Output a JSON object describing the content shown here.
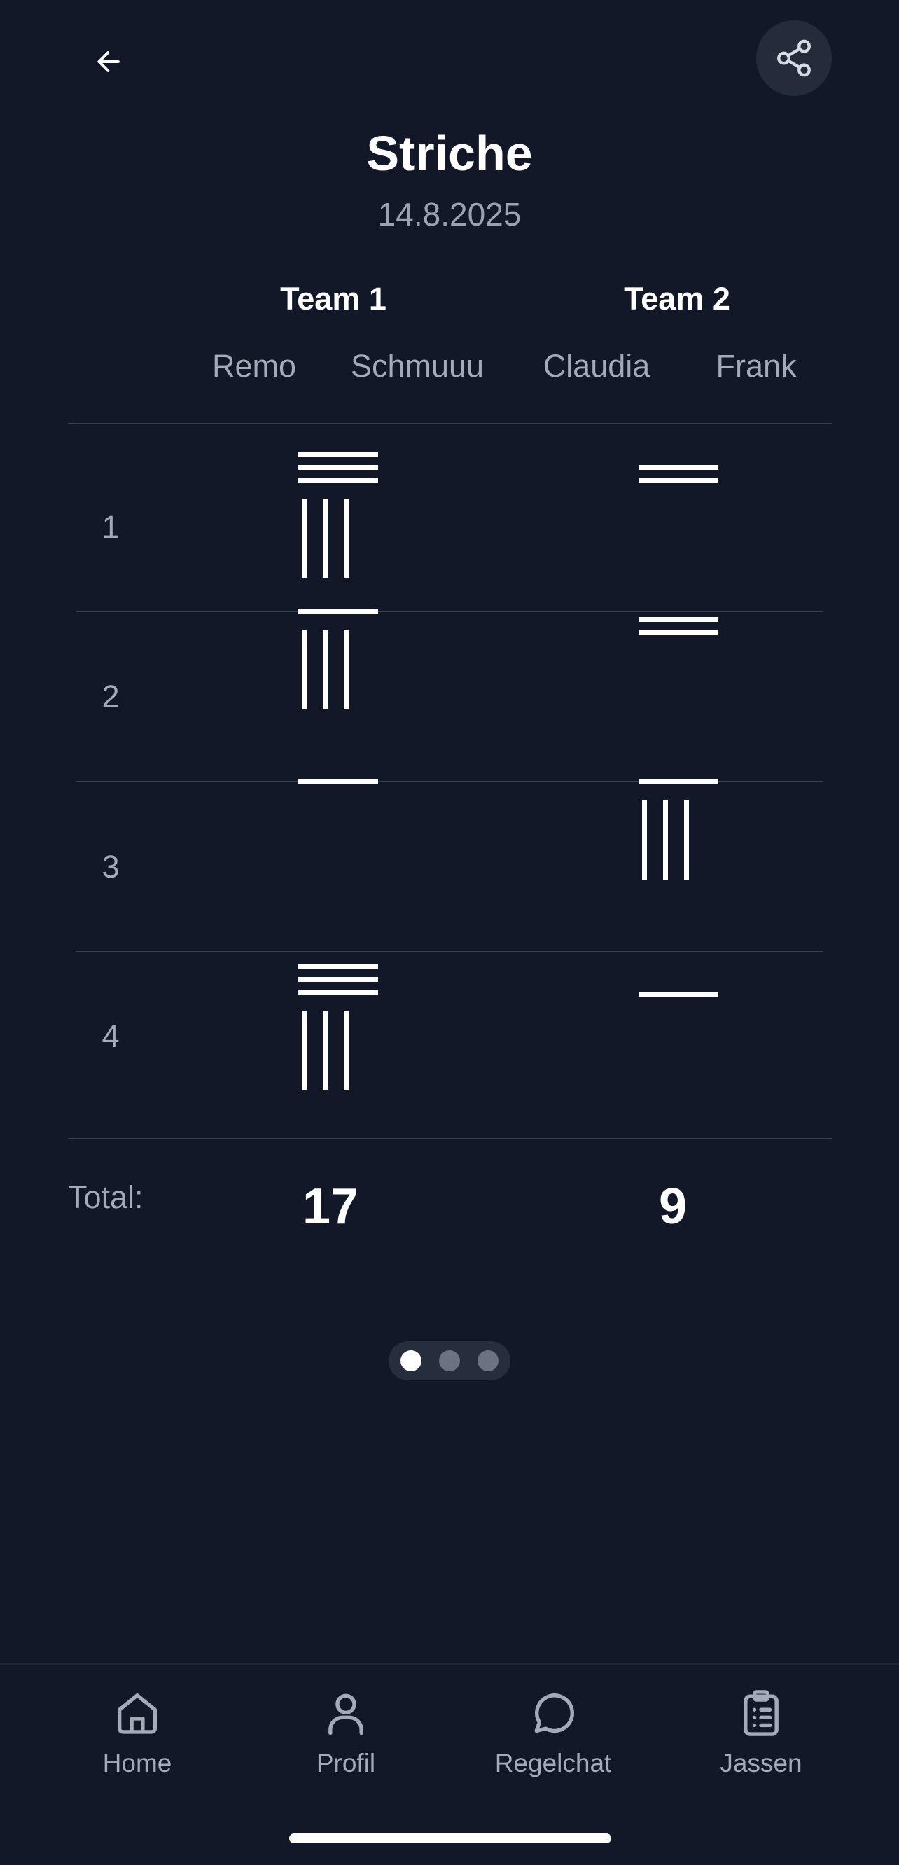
{
  "header": {
    "back_icon": "arrow-left-icon",
    "share_icon": "share-icon",
    "title": "Striche",
    "date": "14.8.2025"
  },
  "teams": [
    {
      "name": "Team 1",
      "players": [
        "Remo",
        "Schmuuu"
      ]
    },
    {
      "name": "Team 2",
      "players": [
        "Claudia",
        "Frank"
      ]
    }
  ],
  "rounds": [
    {
      "label": "1",
      "team1": {
        "horizontal": 3,
        "vertical": 3
      },
      "team2": {
        "horizontal": 2,
        "vertical": 0
      }
    },
    {
      "label": "2",
      "team1": {
        "horizontal": 1,
        "vertical": 3
      },
      "team2": {
        "horizontal": 2,
        "vertical": 0
      }
    },
    {
      "label": "3",
      "team1": {
        "horizontal": 1,
        "vertical": 0
      },
      "team2": {
        "horizontal": 1,
        "vertical": 3
      }
    },
    {
      "label": "4",
      "team1": {
        "horizontal": 3,
        "vertical": 3
      },
      "team2": {
        "horizontal": 1,
        "vertical": 0
      }
    }
  ],
  "totals": {
    "label": "Total:",
    "team1": "17",
    "team2": "9"
  },
  "pager": {
    "pages": 3,
    "active": 1
  },
  "nav": [
    {
      "label": "Home",
      "icon": "home-icon"
    },
    {
      "label": "Profil",
      "icon": "user-icon"
    },
    {
      "label": "Regelchat",
      "icon": "chat-bubble-icon"
    },
    {
      "label": "Jassen",
      "icon": "clipboard-list-icon"
    }
  ],
  "colors": {
    "background": "#121828",
    "text": "#ffffff",
    "muted": "#a3abb9",
    "divider": "#3b4352",
    "dot_active": "#ffffff",
    "dot_inactive": "#6b7383"
  }
}
